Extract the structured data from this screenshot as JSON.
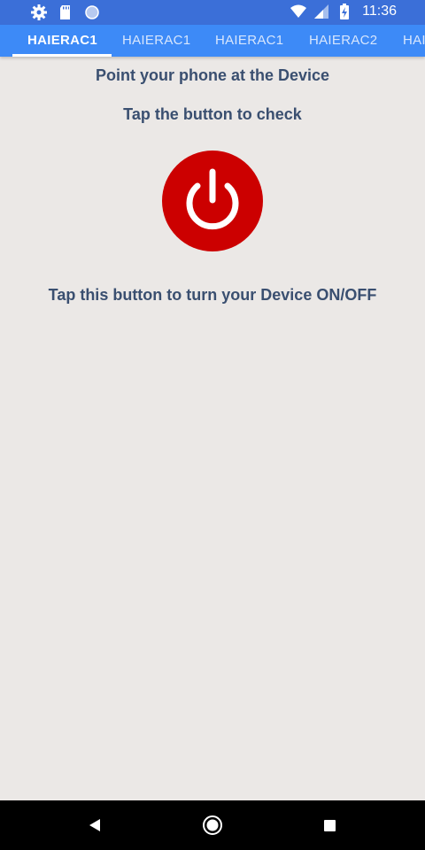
{
  "status_bar": {
    "time": "11:36",
    "icons": [
      "settings-icon",
      "sd-card-icon",
      "circle-icon",
      "wifi-icon",
      "cell-signal-icon",
      "battery-charging-icon"
    ]
  },
  "tabs": [
    {
      "label": "HAIERAC1",
      "active": true
    },
    {
      "label": "HAIERAC1",
      "active": false
    },
    {
      "label": "HAIERAC1",
      "active": false
    },
    {
      "label": "HAIERAC2",
      "active": false
    },
    {
      "label": "HAI",
      "active": false
    }
  ],
  "main": {
    "instruction_point": "Point your phone at the Device",
    "instruction_tap": "Tap the button to check",
    "power_button_icon": "power-icon",
    "power_button_color": "#cc0000",
    "instruction_toggle": "Tap this button to turn your Device ON/OFF"
  },
  "nav_bar": {
    "buttons": [
      "back-icon",
      "home-icon",
      "recents-icon"
    ]
  },
  "colors": {
    "status_bar": "#3b6fd8",
    "tab_bar": "#3d8af7",
    "background": "#ebe8e6",
    "text": "#3a4f70"
  }
}
